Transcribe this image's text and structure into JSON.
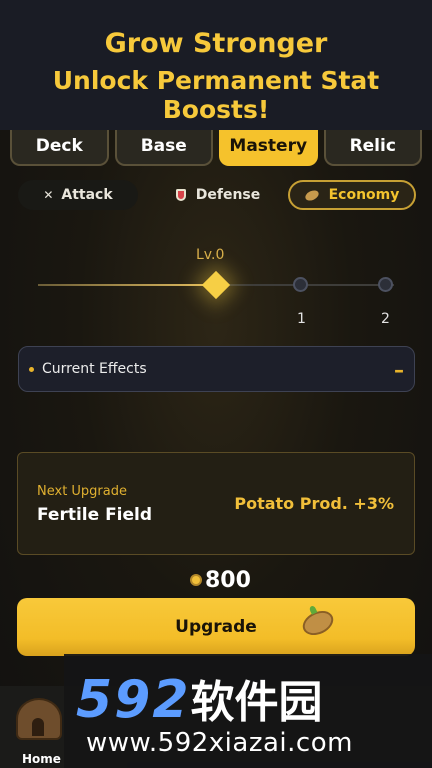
{
  "banner": {
    "line1": "Grow Stronger",
    "line2": "Unlock Permanent Stat Boosts!"
  },
  "tabs": [
    {
      "label": "Deck",
      "active": false
    },
    {
      "label": "Base",
      "active": false
    },
    {
      "label": "Mastery",
      "active": true
    },
    {
      "label": "Relic",
      "active": false
    }
  ],
  "subtabs": [
    {
      "label": "Attack",
      "icon": "crossed-swords-icon",
      "active": false
    },
    {
      "label": "Defense",
      "icon": "shield-icon",
      "active": false
    },
    {
      "label": "Economy",
      "icon": "potato-icon",
      "active": true
    }
  ],
  "mastery": {
    "current_level_label": "Lv.0",
    "level_labels": [
      "1",
      "2"
    ],
    "current_level": 0
  },
  "effects": {
    "label": "Current Effects",
    "collapse_symbol": "–"
  },
  "upgrade_card": {
    "heading": "Next Upgrade",
    "name": "Fertile Field",
    "effect": "Potato Prod. +3%"
  },
  "cost": {
    "value": "800",
    "icon": "coin-icon"
  },
  "upgrade_button": {
    "label": "Upgrade",
    "icon": "potato-icon"
  },
  "nav": {
    "home_label": "Home",
    "home_icon": "hut-icon"
  },
  "watermark": {
    "brand_num": "592",
    "brand_cn": "软件园",
    "url": "www.592xiazai.com"
  },
  "colors": {
    "accent": "#f5c22c",
    "banner_bg": "#1a1c25",
    "card_border": "#5a4b25"
  }
}
